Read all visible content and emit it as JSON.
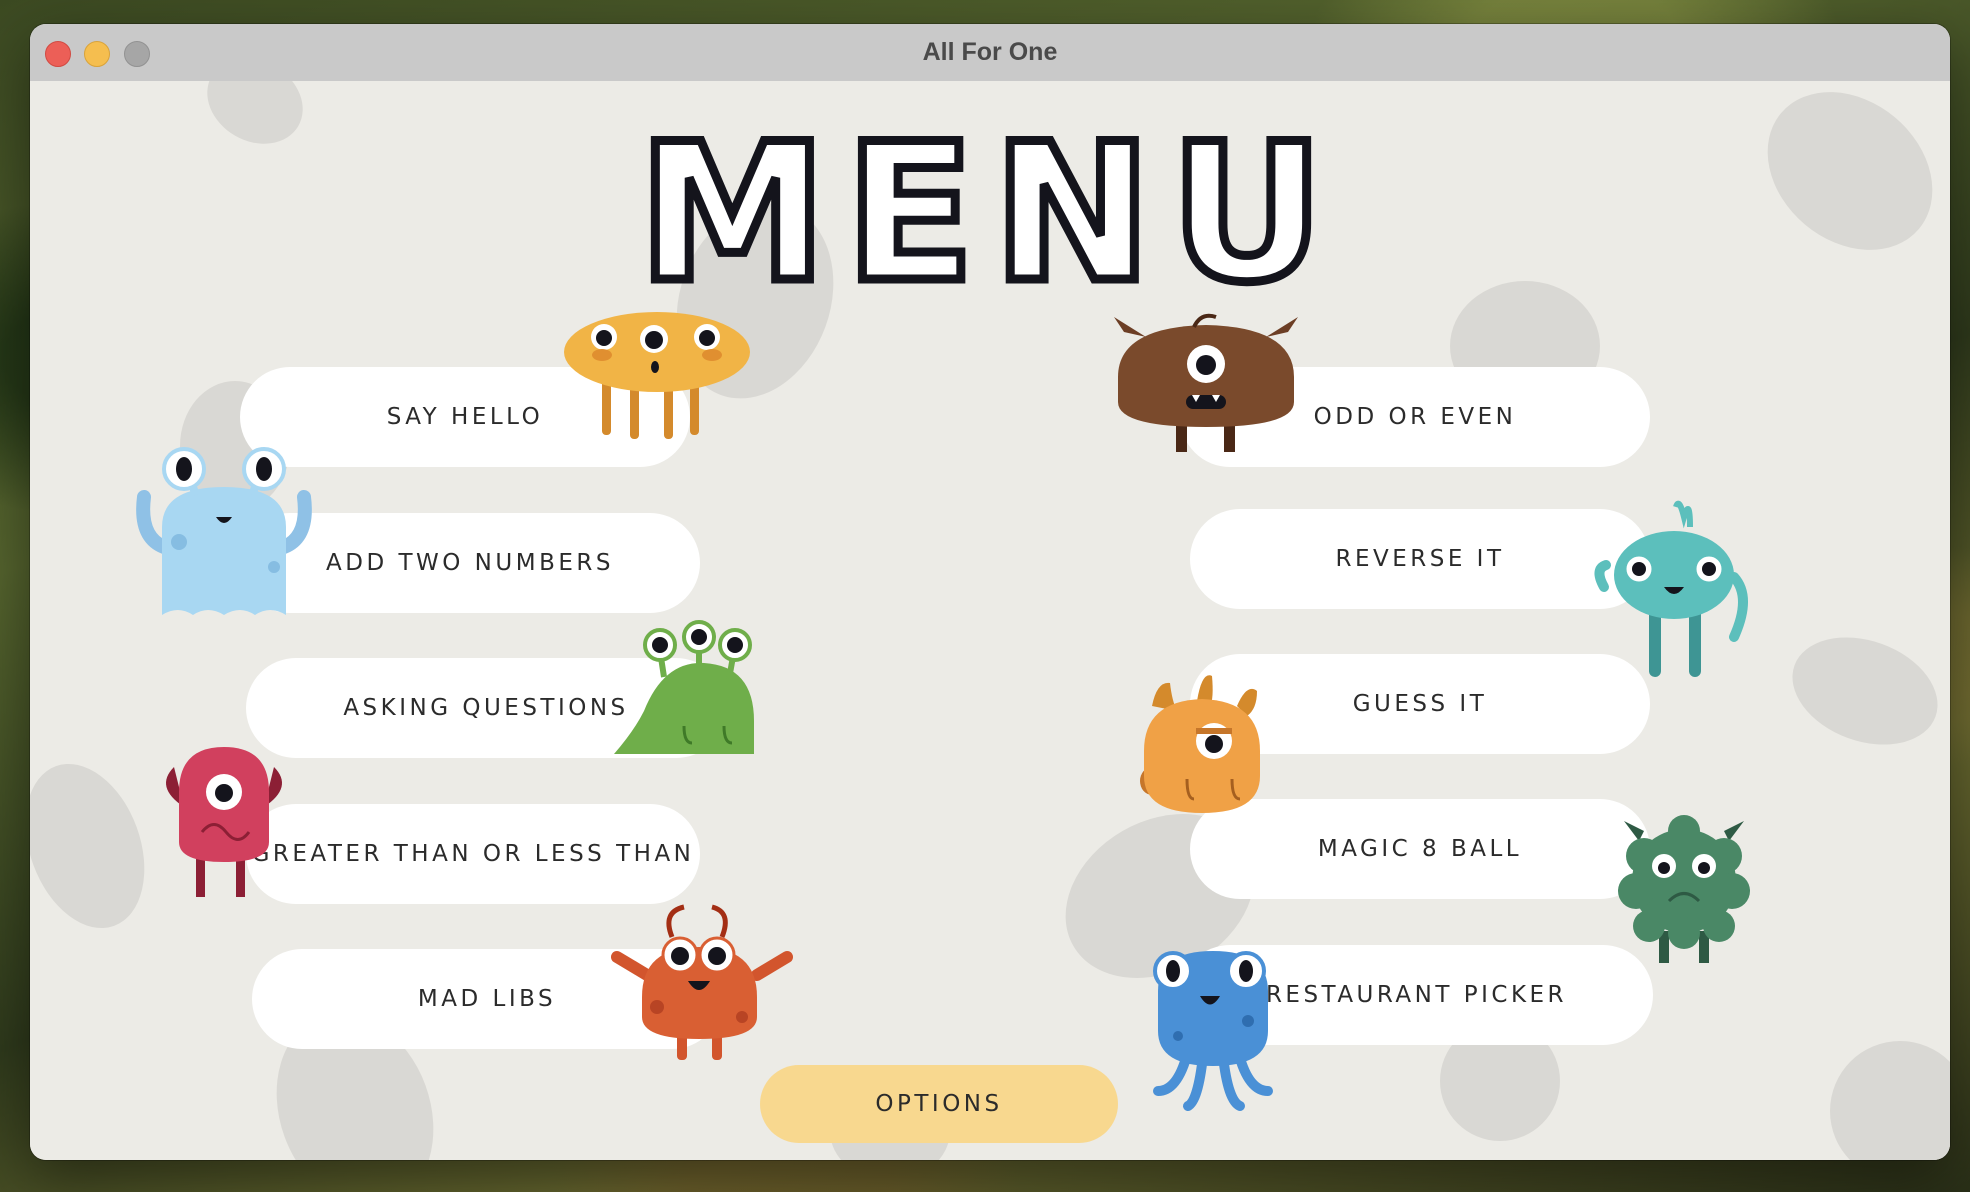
{
  "window": {
    "title": "All For One"
  },
  "menu": {
    "title": "MENU"
  },
  "left_buttons": [
    {
      "label": "SAY HELLO"
    },
    {
      "label": "ADD TWO NUMBERS"
    },
    {
      "label": "ASKING QUESTIONS"
    },
    {
      "label": "GREATER THAN OR LESS THAN"
    },
    {
      "label": "MAD LIBS"
    }
  ],
  "right_buttons": [
    {
      "label": "ODD OR EVEN"
    },
    {
      "label": "REVERSE IT"
    },
    {
      "label": "GUESS IT"
    },
    {
      "label": "MAGIC 8 BALL"
    },
    {
      "label": "RESTAURANT PICKER"
    }
  ],
  "options": {
    "label": "OPTIONS"
  },
  "colors": {
    "window_bg": "#ecebe6",
    "button_bg": "#ffffff",
    "options_bg": "#f8d88f",
    "title_stroke": "#14141c"
  },
  "icons": [
    "yellow-three-eyed-monster-icon",
    "blue-ghost-monster-icon",
    "green-slime-monster-icon",
    "pink-horned-monster-icon",
    "orange-antenna-monster-icon",
    "brown-one-eyed-monster-icon",
    "teal-waving-monster-icon",
    "orange-horned-monster-icon",
    "green-fuzzy-monster-icon",
    "blue-octopus-monster-icon"
  ]
}
